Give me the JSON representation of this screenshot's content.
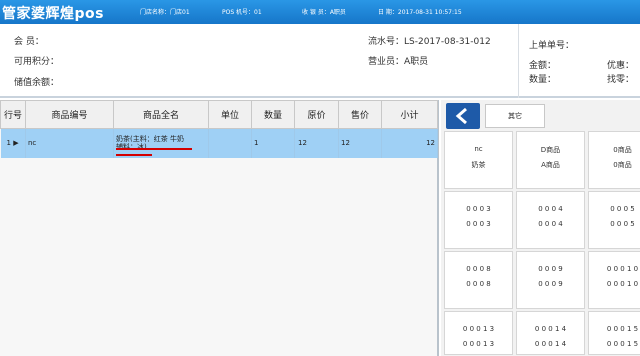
{
  "titlebar": {
    "app_title": "管家婆辉煌pos",
    "store": "门店名称：门店01",
    "pos_no": "POS 机号：01",
    "cashier": "收 银 员：A职员",
    "date": "日    期：2017-08-31 10:57:15"
  },
  "info": {
    "member_label": "会     员：",
    "points_label": "可用积分：",
    "balance_label": "储值余额：",
    "serial_label": "流水号：LS-2017-08-31-012",
    "clerk_label": "营业员：A职员",
    "prev_order_label": "上单单号：",
    "amount_label": "金额：",
    "discount_label": "优惠：",
    "qty_label": "数量：",
    "change_label": "找零："
  },
  "table": {
    "headers": [
      "行号",
      "商品编号",
      "商品全名",
      "单位",
      "数量",
      "原价",
      "售价",
      "小计"
    ],
    "rows": [
      {
        "line": "1",
        "code": "nc",
        "name_line1": "奶茶(主料：红茶 牛奶",
        "name_line2": "辅料：冰)",
        "unit": "",
        "qty": "1",
        "orig_price": "12",
        "price": "12",
        "subtotal": "12"
      }
    ]
  },
  "side": {
    "other_tab": "其它",
    "products": [
      {
        "l1": "nc",
        "l2": "奶茶"
      },
      {
        "l1": "D商品",
        "l2": "A商品"
      },
      {
        "l1": "0商品",
        "l2": "0商品"
      },
      {
        "l1": "0 0 0 3",
        "l2": "0 0 0 3"
      },
      {
        "l1": "0 0 0 4",
        "l2": "0 0 0 4"
      },
      {
        "l1": "0 0 0 5",
        "l2": "0 0 0 5"
      },
      {
        "l1": "0 0 0 8",
        "l2": "0 0 0 8"
      },
      {
        "l1": "0 0 0 9",
        "l2": "0 0 0 9"
      },
      {
        "l1": "0 0 0 1 0",
        "l2": "0 0 0 1 0"
      },
      {
        "l1": "0 0 0 1 3",
        "l2": "0 0 0 1 3"
      },
      {
        "l1": "0 0 0 1 4",
        "l2": "0 0 0 1 4"
      },
      {
        "l1": "0 0 0 1 5",
        "l2": "0 0 0 1 5"
      }
    ]
  },
  "colors": {
    "titlebar": "#1e86d8",
    "selected_row": "#9fd0f5",
    "back_button": "#1e5aa8",
    "annotation": "#d40000"
  }
}
